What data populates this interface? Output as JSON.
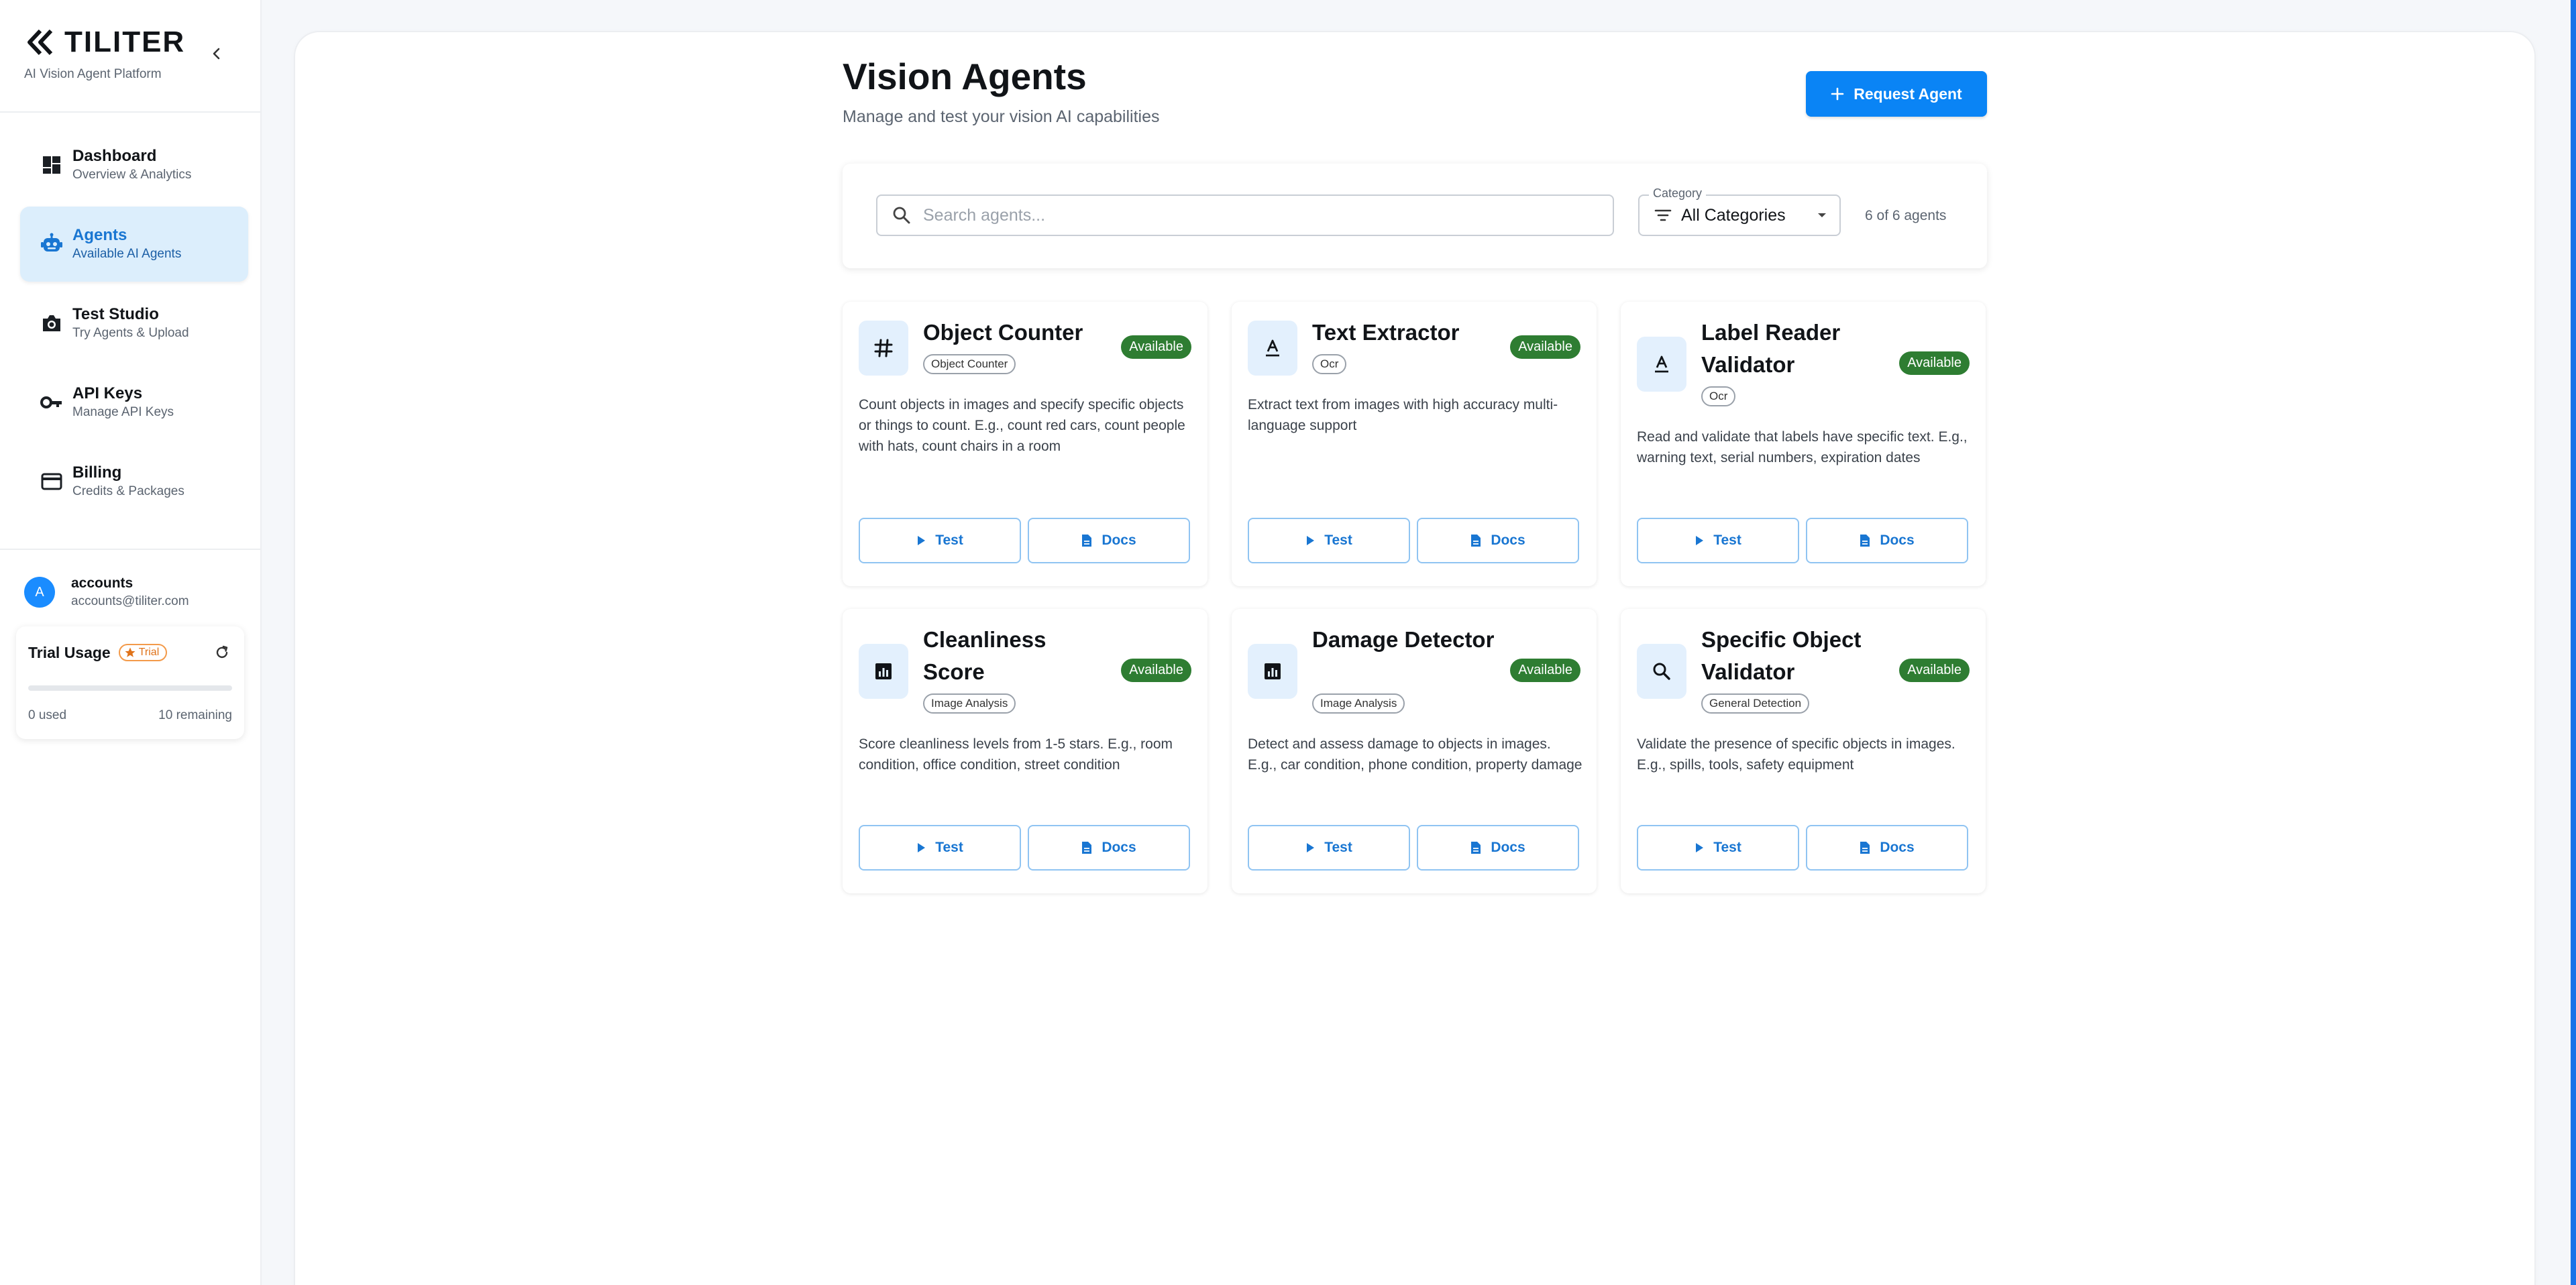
{
  "brand": {
    "name": "TILITER",
    "subtitle": "AI Vision Agent Platform"
  },
  "sidebar": {
    "items": [
      {
        "title": "Dashboard",
        "sub": "Overview & Analytics",
        "icon": "dashboard-icon"
      },
      {
        "title": "Agents",
        "sub": "Available AI Agents",
        "icon": "robot-icon",
        "active": true
      },
      {
        "title": "Test Studio",
        "sub": "Try Agents & Upload",
        "icon": "camera-icon"
      },
      {
        "title": "API Keys",
        "sub": "Manage API Keys",
        "icon": "key-icon"
      },
      {
        "title": "Billing",
        "sub": "Credits & Packages",
        "icon": "credit-card-icon"
      }
    ]
  },
  "user": {
    "initial": "A",
    "name": "accounts",
    "email": "accounts@tiliter.com"
  },
  "trial": {
    "title": "Trial Usage",
    "badge": "Trial",
    "used_label": "0 used",
    "remaining_label": "10 remaining",
    "progress_percent": 0
  },
  "header": {
    "title": "Vision Agents",
    "subtitle": "Manage and test your vision AI capabilities",
    "request_button": "Request Agent"
  },
  "filters": {
    "search_placeholder": "Search agents...",
    "category_label": "Category",
    "category_value": "All Categories",
    "count": "6 of 6 agents"
  },
  "agents": [
    {
      "title": "Object Counter",
      "tag": "Object Counter",
      "status": "Available",
      "icon": "hash-icon",
      "description": "Count objects in images and specify specific objects or things to count. E.g., count red cars, count people with hats, count chairs in a room",
      "test_label": "Test",
      "docs_label": "Docs"
    },
    {
      "title": "Text Extractor",
      "tag": "Ocr",
      "status": "Available",
      "icon": "text-format-icon",
      "description": "Extract text from images with high accuracy multi-language support",
      "test_label": "Test",
      "docs_label": "Docs"
    },
    {
      "title": "Label Reader Validator",
      "tag": "Ocr",
      "status": "Available",
      "icon": "text-format-icon",
      "description": "Read and validate that labels have specific text. E.g., warning text, serial numbers, expiration dates",
      "test_label": "Test",
      "docs_label": "Docs"
    },
    {
      "title": "Cleanliness Score",
      "tag": "Image Analysis",
      "status": "Available",
      "icon": "bar-chart-icon",
      "description": "Score cleanliness levels from 1-5 stars. E.g., room condition, office condition, street condition",
      "test_label": "Test",
      "docs_label": "Docs"
    },
    {
      "title": "Damage Detector",
      "tag": "Image Analysis",
      "status": "Available",
      "icon": "bar-chart-icon",
      "description": "Detect and assess damage to objects in images. E.g., car condition, phone condition, property damage",
      "test_label": "Test",
      "docs_label": "Docs"
    },
    {
      "title": "Specific Object Validator",
      "tag": "General Detection",
      "status": "Available",
      "icon": "search-icon",
      "description": "Validate the presence of specific objects in images. E.g., spills, tools, safety equipment",
      "test_label": "Test",
      "docs_label": "Docs"
    }
  ],
  "colors": {
    "accent": "#0a84f5",
    "available": "#2e7d32",
    "active_nav_bg": "#dceefc"
  }
}
